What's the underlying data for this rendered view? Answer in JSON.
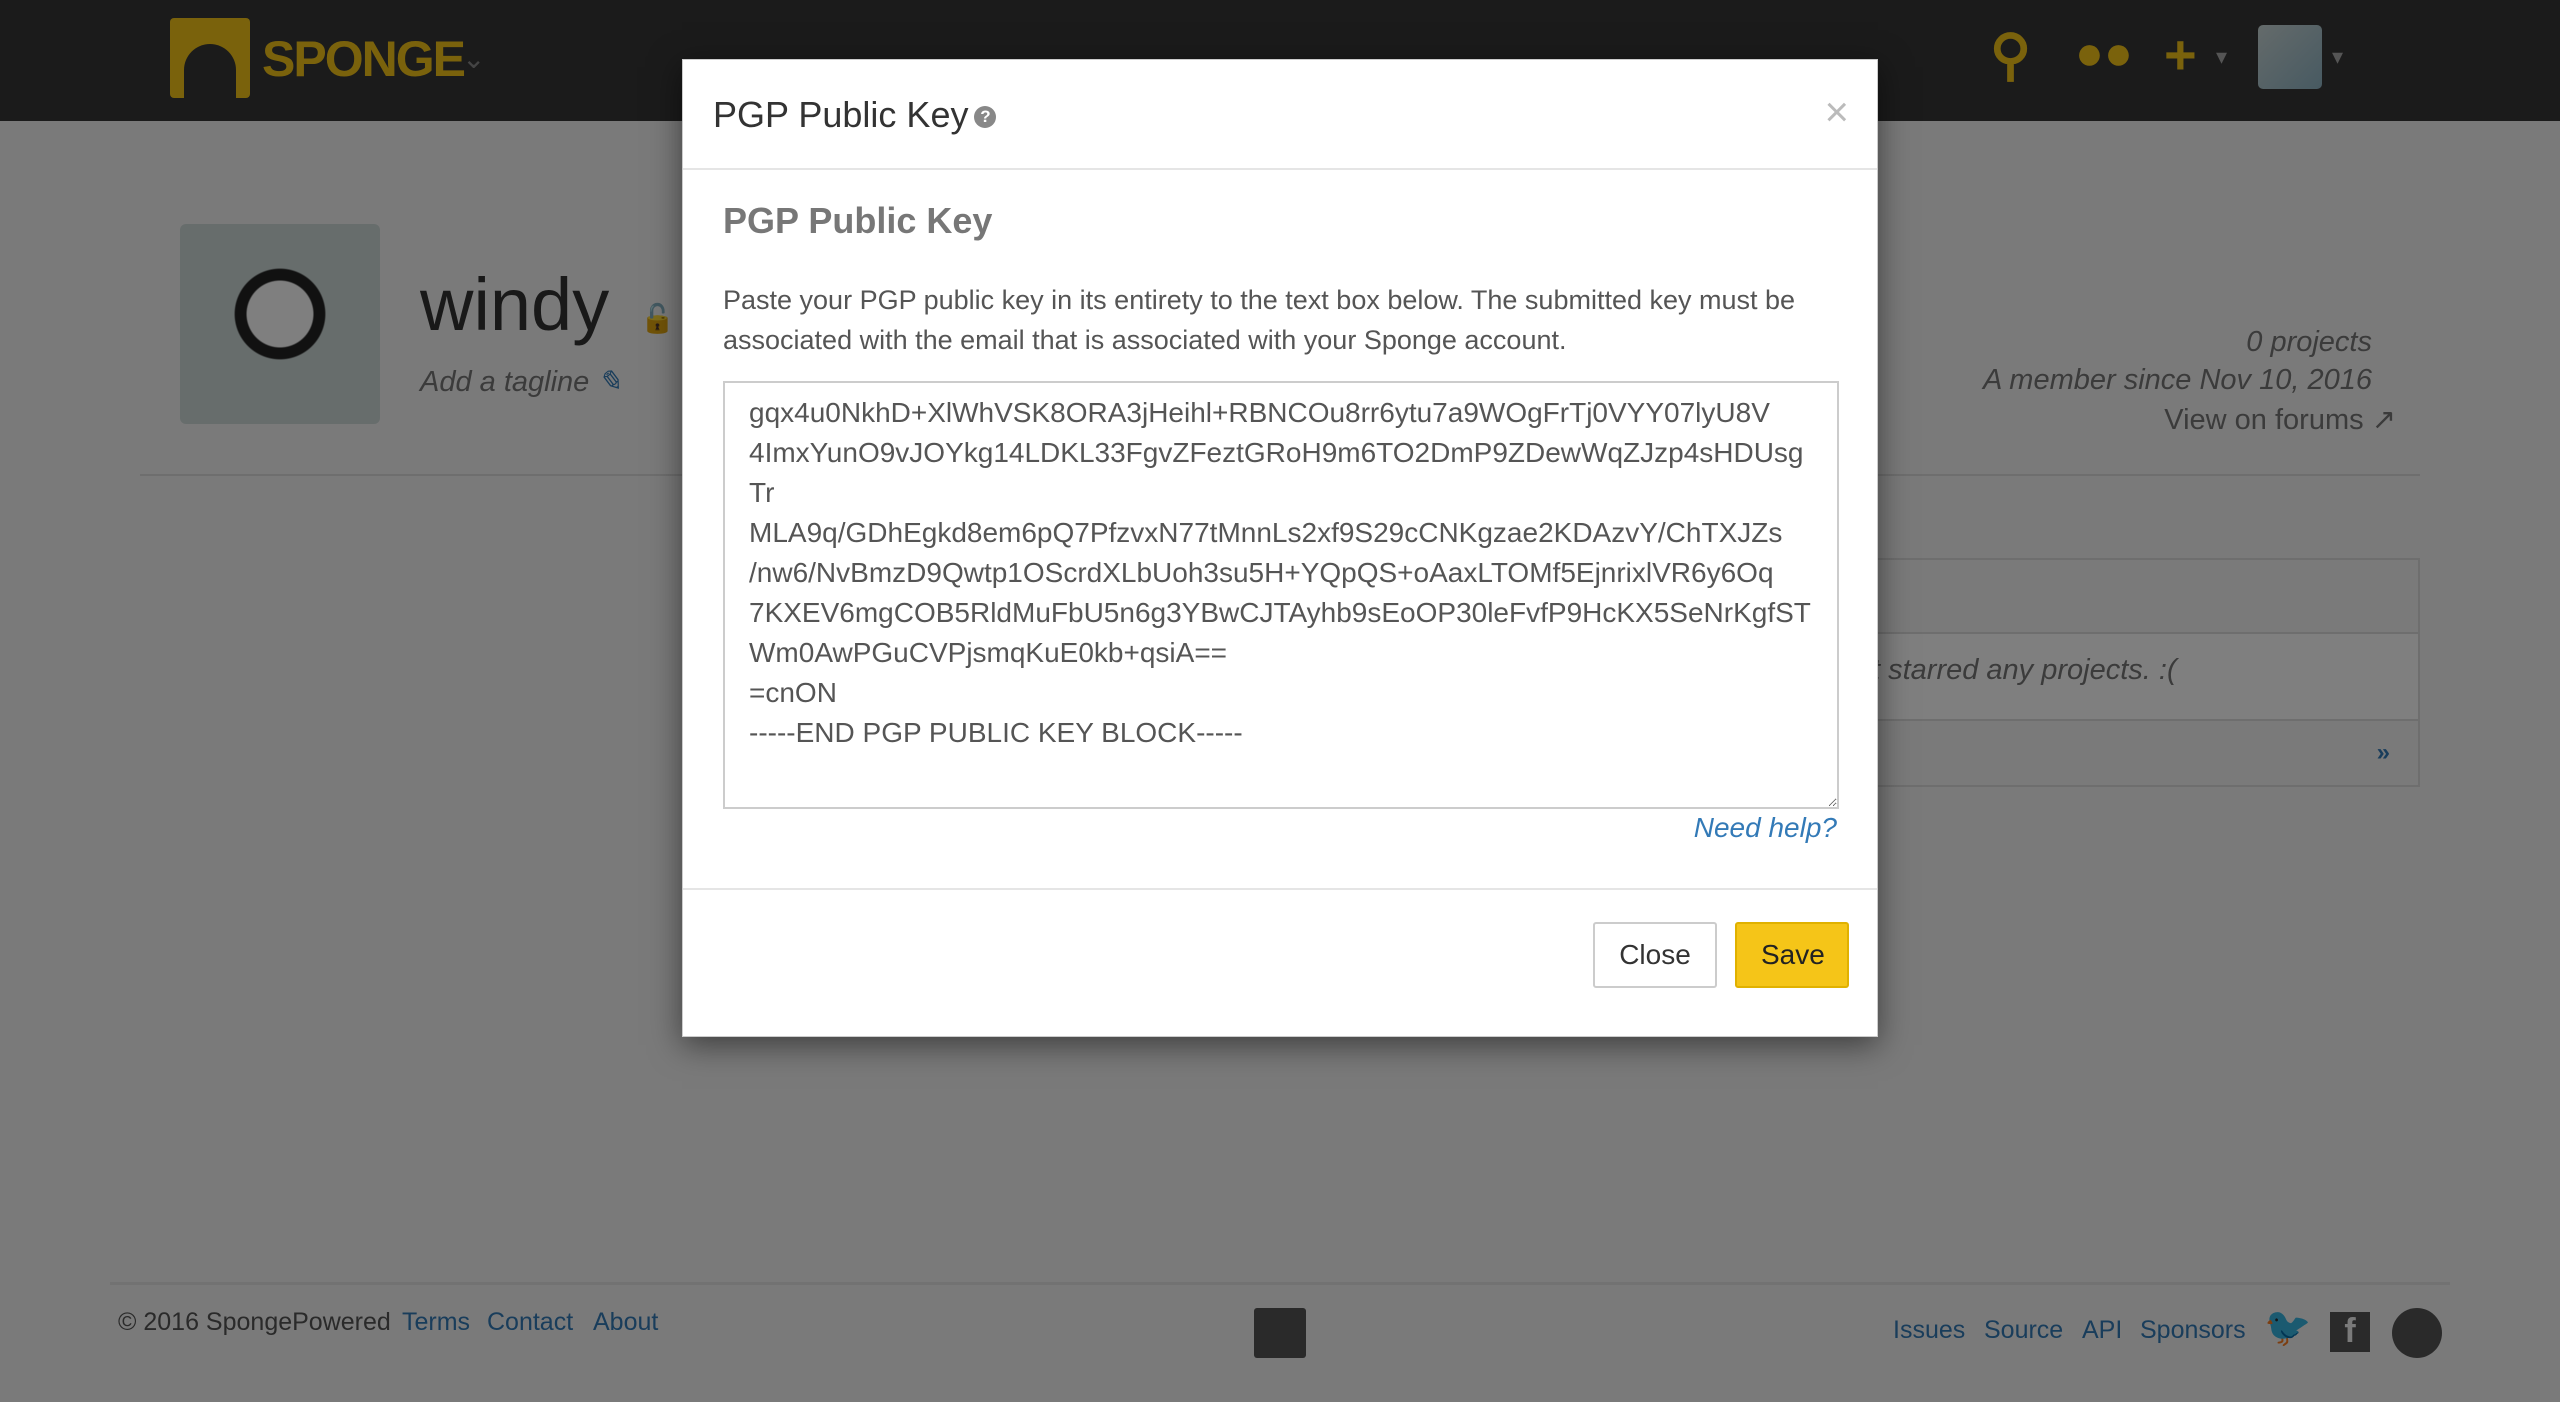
{
  "header": {
    "brand": "SPONGE",
    "icons": [
      "search-icon",
      "users-icon",
      "plus-icon",
      "user-avatar"
    ]
  },
  "profile": {
    "username": "windy",
    "tagline": "Add a tagline",
    "projects": "0 projects",
    "member_since": "A member since Nov 10, 2016",
    "forums_link": "View on forums"
  },
  "starred": {
    "empty_text": "t starred any projects. :(",
    "next": "»"
  },
  "footer": {
    "copyright": "© 2016 SpongePowered",
    "left_links": [
      "Terms",
      "Contact",
      "About"
    ],
    "right_links": [
      "Issues",
      "Source",
      "API",
      "Sponsors"
    ]
  },
  "modal": {
    "title": "PGP Public Key",
    "heading": "PGP Public Key",
    "description": "Paste your PGP public key in its entirety to the text box below. The submitted key must be associated with the email that is associated with your Sponge account.",
    "key_value": "gqx4u0NkhD+XlWhVSK8ORA3jHeihl+RBNCOu8rr6ytu7a9WOgFrTj0VYY07lyU8V\n4ImxYunO9vJOYkg14LDKL33FgvZFeztGRoH9m6TO2DmP9ZDewWqZJzp4sHDUsg\nTr\nMLA9q/GDhEgkd8em6pQ7PfzvxN77tMnnLs2xf9S29cCNKgzae2KDAzvY/ChTXJZs\n/nw6/NvBmzD9Qwtp1OScrdXLbUoh3su5H+YQpQS+oAaxLTOMf5EjnrixlVR6y6Oq\n7KXEV6mgCOB5RldMuFbU5n6g3YBwCJTAyhb9sEoOP30leFvfP9HcKX5SeNrKgfST\nWm0AwPGuCVPjsmqKuE0kb+qsiA==\n=cnON\n-----END PGP PUBLIC KEY BLOCK-----",
    "need_help": "Need help?",
    "close_label": "Close",
    "save_label": "Save"
  },
  "colors": {
    "accent": "#f5c518",
    "link": "#337ab7"
  }
}
